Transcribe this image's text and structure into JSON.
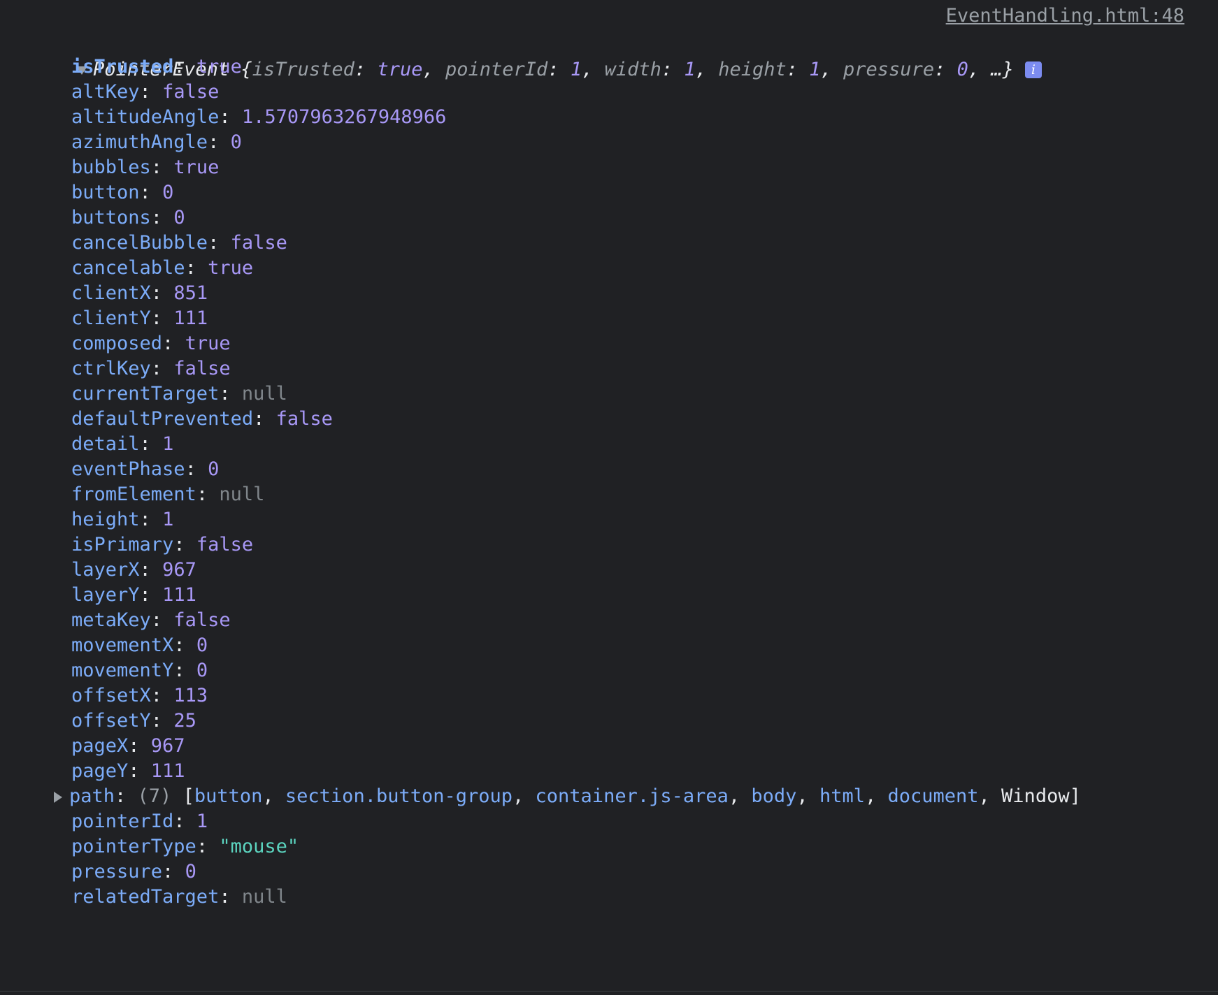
{
  "source_link": "EventHandling.html:48",
  "header": {
    "class_name": "PointerEvent",
    "open_brace": " {",
    "preview": [
      {
        "key": "isTrusted",
        "value": "true"
      },
      {
        "key": "pointerId",
        "value": "1"
      },
      {
        "key": "width",
        "value": "1"
      },
      {
        "key": "height",
        "value": "1"
      },
      {
        "key": "pressure",
        "value": "0"
      }
    ],
    "ellipsis": ", …}",
    "info_badge": "i"
  },
  "properties": [
    {
      "key": "isTrusted",
      "value": "true",
      "type": "bool",
      "bold": true
    },
    {
      "key": "altKey",
      "value": "false",
      "type": "bool"
    },
    {
      "key": "altitudeAngle",
      "value": "1.5707963267948966",
      "type": "num"
    },
    {
      "key": "azimuthAngle",
      "value": "0",
      "type": "num"
    },
    {
      "key": "bubbles",
      "value": "true",
      "type": "bool"
    },
    {
      "key": "button",
      "value": "0",
      "type": "num"
    },
    {
      "key": "buttons",
      "value": "0",
      "type": "num"
    },
    {
      "key": "cancelBubble",
      "value": "false",
      "type": "bool"
    },
    {
      "key": "cancelable",
      "value": "true",
      "type": "bool"
    },
    {
      "key": "clientX",
      "value": "851",
      "type": "num"
    },
    {
      "key": "clientY",
      "value": "111",
      "type": "num"
    },
    {
      "key": "composed",
      "value": "true",
      "type": "bool"
    },
    {
      "key": "ctrlKey",
      "value": "false",
      "type": "bool"
    },
    {
      "key": "currentTarget",
      "value": "null",
      "type": "null"
    },
    {
      "key": "defaultPrevented",
      "value": "false",
      "type": "bool"
    },
    {
      "key": "detail",
      "value": "1",
      "type": "num"
    },
    {
      "key": "eventPhase",
      "value": "0",
      "type": "num"
    },
    {
      "key": "fromElement",
      "value": "null",
      "type": "null"
    },
    {
      "key": "height",
      "value": "1",
      "type": "num"
    },
    {
      "key": "isPrimary",
      "value": "false",
      "type": "bool"
    },
    {
      "key": "layerX",
      "value": "967",
      "type": "num"
    },
    {
      "key": "layerY",
      "value": "111",
      "type": "num"
    },
    {
      "key": "metaKey",
      "value": "false",
      "type": "bool"
    },
    {
      "key": "movementX",
      "value": "0",
      "type": "num"
    },
    {
      "key": "movementY",
      "value": "0",
      "type": "num"
    },
    {
      "key": "offsetX",
      "value": "113",
      "type": "num"
    },
    {
      "key": "offsetY",
      "value": "25",
      "type": "num"
    },
    {
      "key": "pageX",
      "value": "967",
      "type": "num"
    },
    {
      "key": "pageY",
      "value": "111",
      "type": "num"
    }
  ],
  "path_row": {
    "key": "path",
    "count": "(7)",
    "items": [
      {
        "text": "button",
        "kind": "node"
      },
      {
        "text": "section.button-group",
        "kind": "node"
      },
      {
        "text": "container.js-area",
        "kind": "node"
      },
      {
        "text": "body",
        "kind": "node"
      },
      {
        "text": "html",
        "kind": "node"
      },
      {
        "text": "document",
        "kind": "node"
      },
      {
        "text": "Window",
        "kind": "win"
      }
    ]
  },
  "properties_after": [
    {
      "key": "pointerId",
      "value": "1",
      "type": "num"
    },
    {
      "key": "pointerType",
      "value": "\"mouse\"",
      "type": "str"
    },
    {
      "key": "pressure",
      "value": "0",
      "type": "num"
    },
    {
      "key": "relatedTarget",
      "value": "null",
      "type": "null"
    }
  ],
  "colors": {
    "background": "#202124",
    "key": "#7cacf8",
    "number_bool": "#a898f6",
    "null": "#80868b",
    "string": "#5cd5c0",
    "info_badge": "#7c8cf0"
  }
}
